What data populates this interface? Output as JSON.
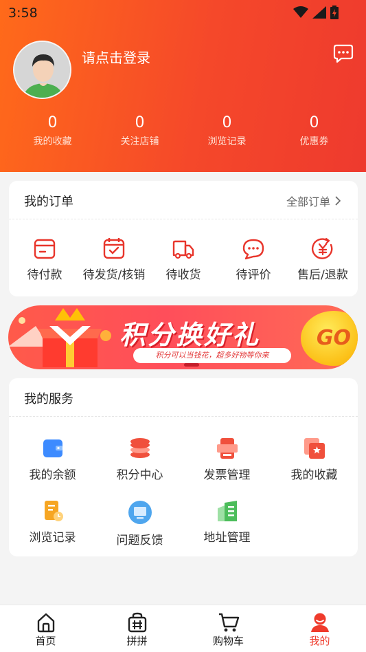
{
  "status_bar": {
    "time": "3:58"
  },
  "profile": {
    "login_prompt": "请点击登录"
  },
  "stats": [
    {
      "value": "0",
      "label": "我的收藏"
    },
    {
      "value": "0",
      "label": "关注店铺"
    },
    {
      "value": "0",
      "label": "浏览记录"
    },
    {
      "value": "0",
      "label": "优惠券"
    }
  ],
  "orders": {
    "title": "我的订单",
    "all_link": "全部订单",
    "items": [
      {
        "label": "待付款",
        "icon": "wallet-card-icon"
      },
      {
        "label": "待发货/核销",
        "icon": "calendar-check-icon"
      },
      {
        "label": "待收货",
        "icon": "truck-icon"
      },
      {
        "label": "待评价",
        "icon": "chat-bubble-icon"
      },
      {
        "label": "售后/退款",
        "icon": "yen-refund-icon"
      }
    ]
  },
  "banner": {
    "title": "积分换好礼",
    "subtitle": "积分可以当钱花，超多好物等你来",
    "button": "GO"
  },
  "services": {
    "title": "我的服务",
    "items": [
      {
        "label": "我的余额",
        "icon": "balance-card-icon",
        "color": "#3d8bff"
      },
      {
        "label": "积分中心",
        "icon": "coin-stack-icon",
        "color": "#f0503c"
      },
      {
        "label": "发票管理",
        "icon": "invoice-icon",
        "color": "#f0503c"
      },
      {
        "label": "我的收藏",
        "icon": "star-folder-icon",
        "color": "#f0503c"
      },
      {
        "label": "浏览记录",
        "icon": "history-doc-icon",
        "color": "#f6a623"
      },
      {
        "label": "问题反馈",
        "icon": "monitor-feedback-icon",
        "color": "#4fa6ee"
      },
      {
        "label": "地址管理",
        "icon": "building-icon",
        "color": "#4cbd5b"
      }
    ]
  },
  "tabbar": [
    {
      "label": "首页",
      "icon": "home-icon"
    },
    {
      "label": "拼拼",
      "icon": "group-buy-icon"
    },
    {
      "label": "购物车",
      "icon": "cart-icon"
    },
    {
      "label": "我的",
      "icon": "user-icon",
      "active": true
    }
  ],
  "colors": {
    "accent": "#ef3b2c",
    "header_start": "#ff6a1a",
    "header_end": "#ee3a2e"
  }
}
